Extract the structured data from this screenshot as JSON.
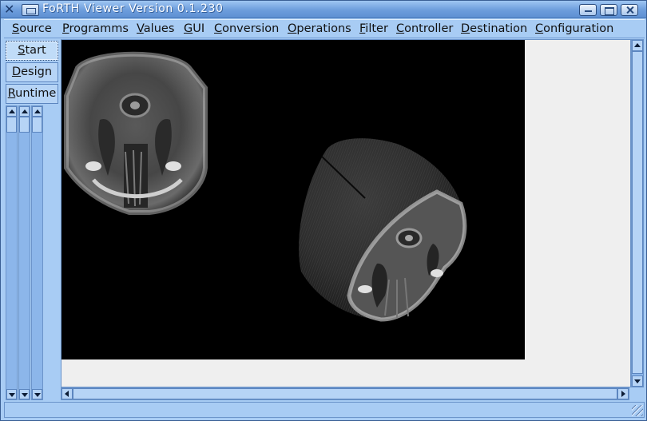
{
  "window": {
    "title": "FoRTH Viewer Version 0.1.230"
  },
  "menubar": {
    "items": [
      {
        "acc": "S",
        "rest": "ource"
      },
      {
        "acc": "P",
        "rest": "rogramms"
      },
      {
        "acc": "V",
        "rest": "alues"
      },
      {
        "acc": "G",
        "rest": "UI"
      },
      {
        "acc": "C",
        "rest": "onversion"
      },
      {
        "acc": "O",
        "rest": "perations"
      },
      {
        "acc": "F",
        "rest": "ilter"
      },
      {
        "acc": "C",
        "rest": "ontroller"
      },
      {
        "acc": "D",
        "rest": "estination"
      },
      {
        "acc": "C",
        "rest": "onfiguration"
      }
    ]
  },
  "sidebar": {
    "buttons": [
      {
        "acc": "S",
        "rest": "tart",
        "active": true
      },
      {
        "acc": "D",
        "rest": "esign",
        "active": false
      },
      {
        "acc": "R",
        "rest": "untime",
        "active": false
      }
    ]
  },
  "statusbar": {
    "text": ""
  },
  "colors": {
    "window_bg": "#a8ccf4",
    "titlebar": "#6d9ddc",
    "canvas_bg": "#000000",
    "view_bg": "#efefef"
  }
}
